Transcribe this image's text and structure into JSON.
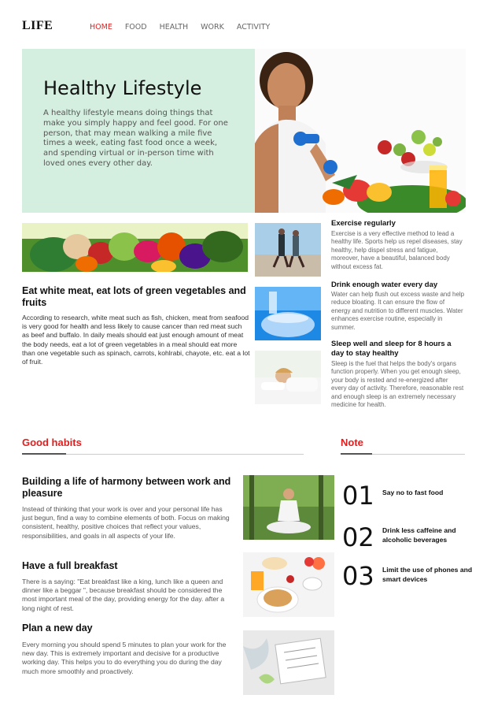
{
  "header": {
    "logo": "LIFE",
    "nav": [
      {
        "label": "HOME",
        "active": true
      },
      {
        "label": "FOOD",
        "active": false
      },
      {
        "label": "HEALTH",
        "active": false
      },
      {
        "label": "WORK",
        "active": false
      },
      {
        "label": "ACTIVITY",
        "active": false
      }
    ]
  },
  "hero": {
    "title": "Healthy Lifestyle",
    "description": "A healthy lifestyle means doing things that make you simply happy and feel good. For one person, that may mean walking a mile five times a week, eating fast food once a week, and spending virtual or in-person time with loved ones every other day."
  },
  "main_article": {
    "title": "Eat white meat, eat lots of green vegetables and fruits",
    "body": "According to research, white meat such as fish, chicken, meat from seafood is very good for health and less likely to cause cancer than red meat such as beef and buffalo. In daily meals should eat just enough amount of meat the body needs, eat a lot of green vegetables in a meal should eat more than one vegetable such as spinach, carrots, kohlrabi, chayote, etc. eat a lot of fruit."
  },
  "side_articles": [
    {
      "title": "Exercise regularly",
      "body": "Exercise is a very effective method to lead a healthy life. Sports help us repel diseases, stay healthy, help dispel stress and fatigue, moreover, have a beautiful, balanced body without excess fat."
    },
    {
      "title": "Drink enough water every day",
      "body": "Water can help flush out excess waste and help reduce bloating. It can ensure the flow of energy and nutrition to different muscles. Water enhances exercise routine, especially in summer."
    },
    {
      "title": "Sleep well and sleep for 8 hours a day to stay healthy",
      "body": "Sleep is the fuel that helps the body's organs function properly. When you get enough sleep, your body is rested and re-energized after every day of activity. Therefore, reasonable rest and enough sleep is an extremely necessary medicine for health."
    }
  ],
  "good_habits": {
    "heading": "Good habits",
    "items": [
      {
        "title": "Building a life of harmony between work and pleasure",
        "body": "Instead of thinking that your work is over and your personal life has just begun, find a way to combine elements of both. Focus on making consistent, healthy, positive choices that reflect your values, responsibilities, and goals in all aspects of your life."
      },
      {
        "title": "Have a full breakfast",
        "body": "There is a saying: \"Eat breakfast like a king, lunch like a queen and dinner like a beggar \", because breakfast should be considered the most important meal of the day, providing energy for the day. after a long night of rest."
      },
      {
        "title": "Plan a new day",
        "body": "Every morning you should spend 5 minutes to plan your work for the new day. This is extremely important and decisive for a productive working day. This helps you to do everything you do during the day much more smoothly and proactively."
      }
    ]
  },
  "notes": {
    "heading": "Note",
    "items": [
      {
        "num": "01",
        "text": "Say no to fast food"
      },
      {
        "num": "02",
        "text": "Drink less caffeine and alcoholic beverages"
      },
      {
        "num": "03",
        "text": "Limit the use of phones and smart devices"
      }
    ]
  },
  "colors": {
    "accent": "#e02020",
    "hero_bg": "#d4eedf"
  }
}
